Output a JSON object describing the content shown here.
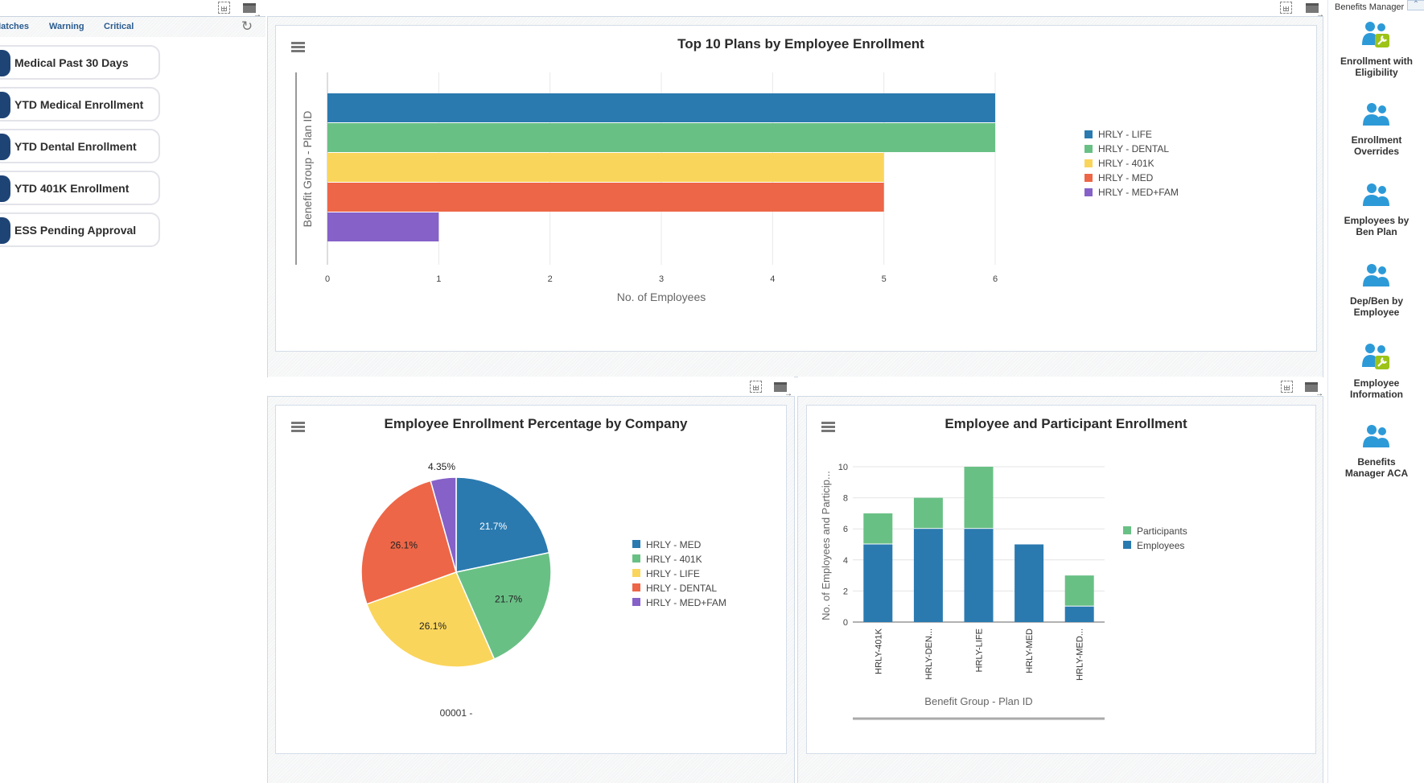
{
  "left_panel": {
    "tabs": [
      "Matches",
      "Warning",
      "Critical"
    ],
    "kpis": [
      {
        "label": "Medical Past 30 Days"
      },
      {
        "label": "YTD Medical Enrollment"
      },
      {
        "label": "YTD Dental Enrollment"
      },
      {
        "label": "YTD 401K Enrollment"
      },
      {
        "label": "ESS Pending Approval"
      }
    ]
  },
  "right_sidebar": {
    "title": "Benefits Manager",
    "items": [
      {
        "label_line1": "Enrollment with",
        "label_line2": "Eligibility",
        "icon": "user-wrench-icon"
      },
      {
        "label_line1": "Enrollment",
        "label_line2": "Overrides",
        "icon": "users-icon"
      },
      {
        "label_line1": "Employees by",
        "label_line2": "Ben Plan",
        "icon": "users-icon"
      },
      {
        "label_line1": "Dep/Ben by",
        "label_line2": "Employee",
        "icon": "users-icon"
      },
      {
        "label_line1": "Employee",
        "label_line2": "Information",
        "icon": "user-wrench-icon"
      },
      {
        "label_line1": "Benefits",
        "label_line2": "Manager ACA",
        "icon": "users-icon"
      }
    ]
  },
  "colors": {
    "blue": "#2a7ab0",
    "green": "#69c085",
    "yellow": "#fad55c",
    "red": "#ed6647",
    "purple": "#8561c8",
    "kpi_accent": "#1e4476"
  },
  "chart_data": [
    {
      "type": "bar",
      "orientation": "horizontal",
      "title": "Top 10 Plans by Employee Enrollment",
      "xlabel": "No. of Employees",
      "ylabel": "Benefit Group - Plan ID",
      "xlim": [
        0,
        6
      ],
      "xticks": [
        "0",
        "1",
        "2",
        "3",
        "4",
        "5",
        "6"
      ],
      "grid": true,
      "legend_position": "right",
      "series": [
        {
          "name": "HRLY - LIFE",
          "value": 6,
          "color": "#2a7ab0"
        },
        {
          "name": "HRLY - DENTAL",
          "value": 6,
          "color": "#69c085"
        },
        {
          "name": "HRLY - 401K",
          "value": 5,
          "color": "#fad55c"
        },
        {
          "name": "HRLY - MED",
          "value": 5,
          "color": "#ed6647"
        },
        {
          "name": "HRLY - MED+FAM",
          "value": 1,
          "color": "#8561c8"
        }
      ]
    },
    {
      "type": "pie",
      "title": "Employee Enrollment Percentage by Company",
      "category_label": "00001 -",
      "legend_position": "right",
      "slices": [
        {
          "name": "HRLY - MED",
          "value": 21.7,
          "label": "21.7%",
          "color": "#2a7ab0"
        },
        {
          "name": "HRLY - 401K",
          "value": 21.7,
          "label": "21.7%",
          "color": "#69c085"
        },
        {
          "name": "HRLY - LIFE",
          "value": 26.1,
          "label": "26.1%",
          "color": "#fad55c"
        },
        {
          "name": "HRLY - DENTAL",
          "value": 26.1,
          "label": "26.1%",
          "color": "#ed6647"
        },
        {
          "name": "HRLY - MED+FAM",
          "value": 4.35,
          "label": "4.35%",
          "color": "#8561c8"
        }
      ]
    },
    {
      "type": "bar",
      "stacked": true,
      "title": "Employee and Participant Enrollment",
      "xlabel": "Benefit Group - Plan ID",
      "ylabel": "No. of Employees and Particip...",
      "ylim": [
        0,
        10
      ],
      "yticks": [
        "0",
        "2",
        "4",
        "6",
        "8",
        "10"
      ],
      "grid": true,
      "legend_position": "right",
      "categories": [
        "HRLY-401K",
        "HRLY-DEN...",
        "HRLY-LIFE",
        "HRLY-MED",
        "HRLY-MED..."
      ],
      "series": [
        {
          "name": "Employees",
          "values": [
            5,
            6,
            6,
            5,
            1
          ],
          "color": "#2a7ab0"
        },
        {
          "name": "Participants",
          "values": [
            2,
            2,
            4,
            0,
            2
          ],
          "color": "#69c085"
        }
      ],
      "legend": [
        "Participants",
        "Employees"
      ]
    }
  ]
}
